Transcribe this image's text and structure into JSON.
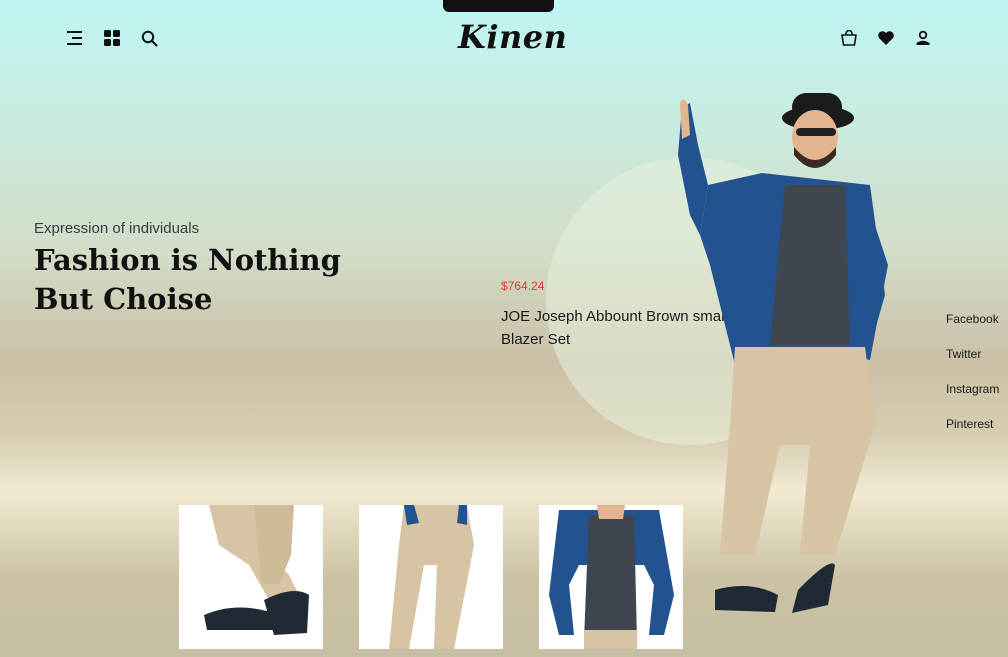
{
  "brand": {
    "logo": "Kinen"
  },
  "header": {
    "left_icons": [
      "menu-icon",
      "grid-icon",
      "search-icon"
    ],
    "right_icons": [
      "cart-icon",
      "heart-icon",
      "user-icon"
    ]
  },
  "hero": {
    "eyebrow": "Expression of individuals",
    "headline_line1": "Fashion is Nothing",
    "headline_line2": "But Choise"
  },
  "product": {
    "price": "$764.24",
    "name": "JOE Joseph Abbount Brown smart Blazer Set"
  },
  "socials": [
    "Facebook",
    "Twitter",
    "Instagram",
    "Pinterest"
  ],
  "thumbnails": [
    "shoes-detail",
    "pants-detail",
    "shirt-detail"
  ],
  "colors": {
    "accent_price": "#e53935",
    "shirt_blue": "#22538f",
    "pants_khaki": "#d6c4a4",
    "text_dark": "#111111"
  }
}
